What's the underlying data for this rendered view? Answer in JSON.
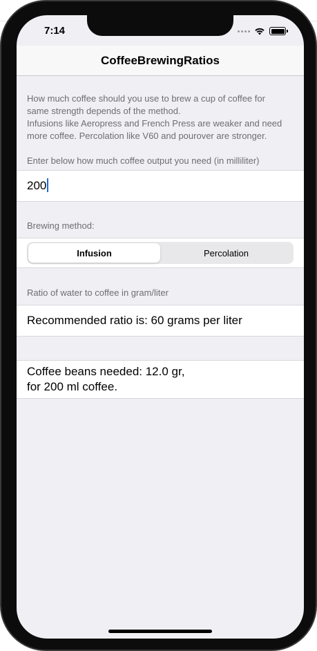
{
  "status_bar": {
    "time": "7:14",
    "icons": [
      "cellular-dots-icon",
      "wifi-icon",
      "battery-icon"
    ]
  },
  "nav": {
    "title": "CoffeeBrewingRatios"
  },
  "intro": {
    "line1": "How much coffee should you use to brew a cup of coffee for",
    "line2": "same strength depends of the method.",
    "line3": "Infusions like Aeropress and French Press are weaker and need",
    "line4": "more coffee. Percolation like V60 and pourover are stronger."
  },
  "output_section": {
    "header": "Enter below how much coffee output you need (in milliliter)",
    "value": "200"
  },
  "method_section": {
    "header": "Brewing method:",
    "options": [
      "Infusion",
      "Percolation"
    ],
    "selected": "Infusion"
  },
  "ratio_section": {
    "header": "Ratio of water to coffee in gram/liter",
    "text": "Recommended ratio is: 60 grams per liter"
  },
  "result": {
    "line1": "Coffee beans needed: 12.0 gr,",
    "line2": "for 200 ml coffee."
  },
  "colors": {
    "background": "#efeff4",
    "cell": "#ffffff",
    "section_text": "#6d6d72",
    "caret": "#1b6bd8"
  }
}
